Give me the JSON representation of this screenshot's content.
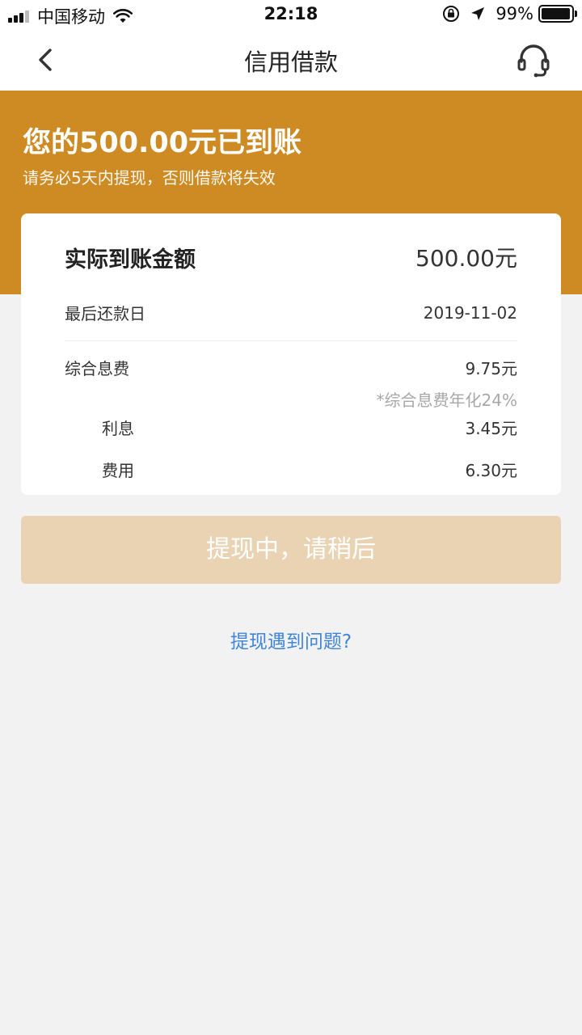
{
  "status_bar": {
    "carrier": "中国移动",
    "time": "22:18",
    "battery_percent": "99%"
  },
  "nav": {
    "title": "信用借款",
    "back_icon": "chevron-left-icon",
    "service_icon": "headset-icon"
  },
  "banner": {
    "title": "您的500.00元已到账",
    "subtitle": "请务必5天内提现，否则借款将失效"
  },
  "details": {
    "amount_label": "实际到账金额",
    "amount_value": "500.00元",
    "due_label": "最后还款日",
    "due_value": "2019-11-02",
    "fee_label": "综合息费",
    "fee_value": "9.75元",
    "fee_note": "*综合息费年化24%",
    "interest_label": "利息",
    "interest_value": "3.45元",
    "cost_label": "费用",
    "cost_value": "6.30元"
  },
  "action": {
    "button_label": "提现中，请稍后",
    "help_link": "提现遇到问题?"
  },
  "colors": {
    "banner": "#cf8b23",
    "button_disabled": "#e9d3b2",
    "link": "#3f86d8",
    "background": "#f2f2f2"
  }
}
